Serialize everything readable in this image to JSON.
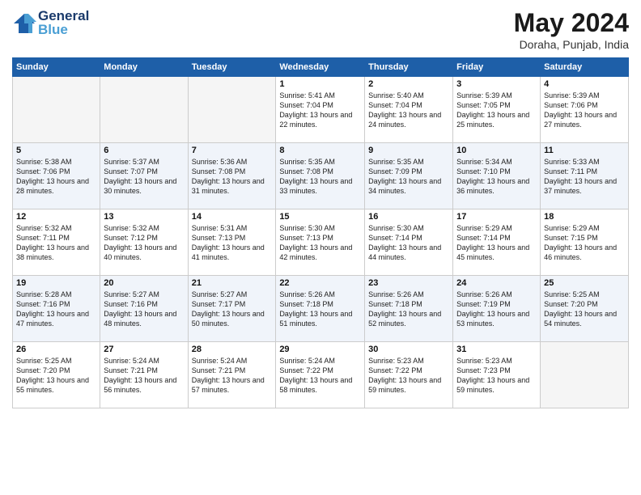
{
  "header": {
    "logo_line1": "General",
    "logo_line2": "Blue",
    "month": "May 2024",
    "location": "Doraha, Punjab, India"
  },
  "weekdays": [
    "Sunday",
    "Monday",
    "Tuesday",
    "Wednesday",
    "Thursday",
    "Friday",
    "Saturday"
  ],
  "weeks": [
    [
      {
        "day": "",
        "sunrise": "",
        "sunset": "",
        "daylight": ""
      },
      {
        "day": "",
        "sunrise": "",
        "sunset": "",
        "daylight": ""
      },
      {
        "day": "",
        "sunrise": "",
        "sunset": "",
        "daylight": ""
      },
      {
        "day": "1",
        "sunrise": "Sunrise: 5:41 AM",
        "sunset": "Sunset: 7:04 PM",
        "daylight": "Daylight: 13 hours and 22 minutes."
      },
      {
        "day": "2",
        "sunrise": "Sunrise: 5:40 AM",
        "sunset": "Sunset: 7:04 PM",
        "daylight": "Daylight: 13 hours and 24 minutes."
      },
      {
        "day": "3",
        "sunrise": "Sunrise: 5:39 AM",
        "sunset": "Sunset: 7:05 PM",
        "daylight": "Daylight: 13 hours and 25 minutes."
      },
      {
        "day": "4",
        "sunrise": "Sunrise: 5:39 AM",
        "sunset": "Sunset: 7:06 PM",
        "daylight": "Daylight: 13 hours and 27 minutes."
      }
    ],
    [
      {
        "day": "5",
        "sunrise": "Sunrise: 5:38 AM",
        "sunset": "Sunset: 7:06 PM",
        "daylight": "Daylight: 13 hours and 28 minutes."
      },
      {
        "day": "6",
        "sunrise": "Sunrise: 5:37 AM",
        "sunset": "Sunset: 7:07 PM",
        "daylight": "Daylight: 13 hours and 30 minutes."
      },
      {
        "day": "7",
        "sunrise": "Sunrise: 5:36 AM",
        "sunset": "Sunset: 7:08 PM",
        "daylight": "Daylight: 13 hours and 31 minutes."
      },
      {
        "day": "8",
        "sunrise": "Sunrise: 5:35 AM",
        "sunset": "Sunset: 7:08 PM",
        "daylight": "Daylight: 13 hours and 33 minutes."
      },
      {
        "day": "9",
        "sunrise": "Sunrise: 5:35 AM",
        "sunset": "Sunset: 7:09 PM",
        "daylight": "Daylight: 13 hours and 34 minutes."
      },
      {
        "day": "10",
        "sunrise": "Sunrise: 5:34 AM",
        "sunset": "Sunset: 7:10 PM",
        "daylight": "Daylight: 13 hours and 36 minutes."
      },
      {
        "day": "11",
        "sunrise": "Sunrise: 5:33 AM",
        "sunset": "Sunset: 7:11 PM",
        "daylight": "Daylight: 13 hours and 37 minutes."
      }
    ],
    [
      {
        "day": "12",
        "sunrise": "Sunrise: 5:32 AM",
        "sunset": "Sunset: 7:11 PM",
        "daylight": "Daylight: 13 hours and 38 minutes."
      },
      {
        "day": "13",
        "sunrise": "Sunrise: 5:32 AM",
        "sunset": "Sunset: 7:12 PM",
        "daylight": "Daylight: 13 hours and 40 minutes."
      },
      {
        "day": "14",
        "sunrise": "Sunrise: 5:31 AM",
        "sunset": "Sunset: 7:13 PM",
        "daylight": "Daylight: 13 hours and 41 minutes."
      },
      {
        "day": "15",
        "sunrise": "Sunrise: 5:30 AM",
        "sunset": "Sunset: 7:13 PM",
        "daylight": "Daylight: 13 hours and 42 minutes."
      },
      {
        "day": "16",
        "sunrise": "Sunrise: 5:30 AM",
        "sunset": "Sunset: 7:14 PM",
        "daylight": "Daylight: 13 hours and 44 minutes."
      },
      {
        "day": "17",
        "sunrise": "Sunrise: 5:29 AM",
        "sunset": "Sunset: 7:14 PM",
        "daylight": "Daylight: 13 hours and 45 minutes."
      },
      {
        "day": "18",
        "sunrise": "Sunrise: 5:29 AM",
        "sunset": "Sunset: 7:15 PM",
        "daylight": "Daylight: 13 hours and 46 minutes."
      }
    ],
    [
      {
        "day": "19",
        "sunrise": "Sunrise: 5:28 AM",
        "sunset": "Sunset: 7:16 PM",
        "daylight": "Daylight: 13 hours and 47 minutes."
      },
      {
        "day": "20",
        "sunrise": "Sunrise: 5:27 AM",
        "sunset": "Sunset: 7:16 PM",
        "daylight": "Daylight: 13 hours and 48 minutes."
      },
      {
        "day": "21",
        "sunrise": "Sunrise: 5:27 AM",
        "sunset": "Sunset: 7:17 PM",
        "daylight": "Daylight: 13 hours and 50 minutes."
      },
      {
        "day": "22",
        "sunrise": "Sunrise: 5:26 AM",
        "sunset": "Sunset: 7:18 PM",
        "daylight": "Daylight: 13 hours and 51 minutes."
      },
      {
        "day": "23",
        "sunrise": "Sunrise: 5:26 AM",
        "sunset": "Sunset: 7:18 PM",
        "daylight": "Daylight: 13 hours and 52 minutes."
      },
      {
        "day": "24",
        "sunrise": "Sunrise: 5:26 AM",
        "sunset": "Sunset: 7:19 PM",
        "daylight": "Daylight: 13 hours and 53 minutes."
      },
      {
        "day": "25",
        "sunrise": "Sunrise: 5:25 AM",
        "sunset": "Sunset: 7:20 PM",
        "daylight": "Daylight: 13 hours and 54 minutes."
      }
    ],
    [
      {
        "day": "26",
        "sunrise": "Sunrise: 5:25 AM",
        "sunset": "Sunset: 7:20 PM",
        "daylight": "Daylight: 13 hours and 55 minutes."
      },
      {
        "day": "27",
        "sunrise": "Sunrise: 5:24 AM",
        "sunset": "Sunset: 7:21 PM",
        "daylight": "Daylight: 13 hours and 56 minutes."
      },
      {
        "day": "28",
        "sunrise": "Sunrise: 5:24 AM",
        "sunset": "Sunset: 7:21 PM",
        "daylight": "Daylight: 13 hours and 57 minutes."
      },
      {
        "day": "29",
        "sunrise": "Sunrise: 5:24 AM",
        "sunset": "Sunset: 7:22 PM",
        "daylight": "Daylight: 13 hours and 58 minutes."
      },
      {
        "day": "30",
        "sunrise": "Sunrise: 5:23 AM",
        "sunset": "Sunset: 7:22 PM",
        "daylight": "Daylight: 13 hours and 59 minutes."
      },
      {
        "day": "31",
        "sunrise": "Sunrise: 5:23 AM",
        "sunset": "Sunset: 7:23 PM",
        "daylight": "Daylight: 13 hours and 59 minutes."
      },
      {
        "day": "",
        "sunrise": "",
        "sunset": "",
        "daylight": ""
      }
    ]
  ]
}
